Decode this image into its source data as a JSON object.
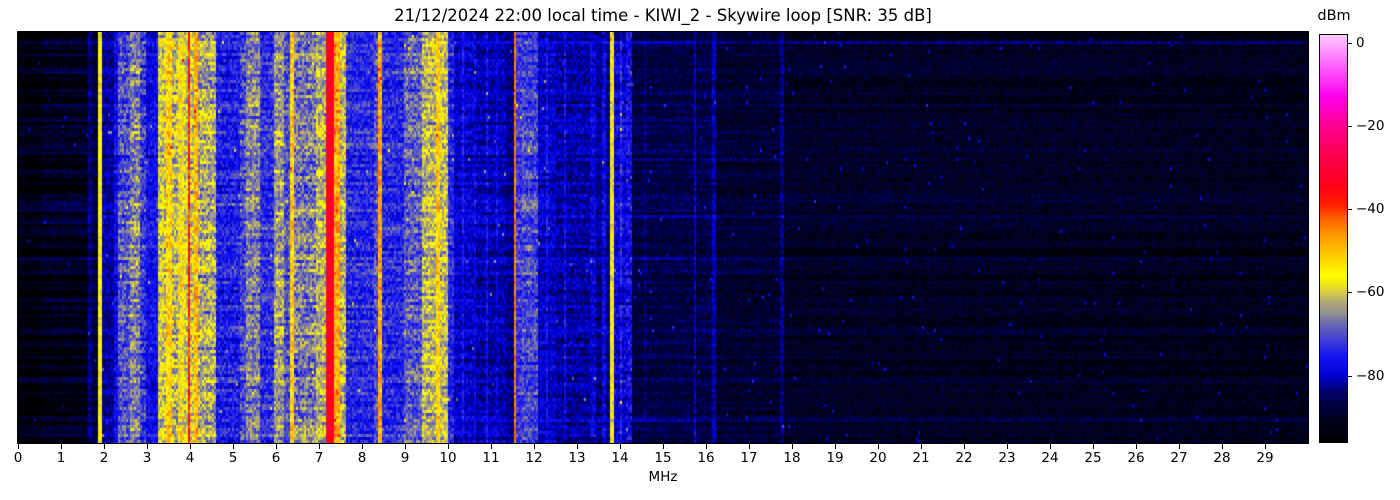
{
  "header": {
    "title": "21/12/2024 22:00 local time - KIWI_2 - Skywire loop [SNR: 35 dB]"
  },
  "chart_data": {
    "type": "heatmap",
    "variant": "radio-spectrum-waterfall",
    "title": "21/12/2024 22:00 local time - KIWI_2 - Skywire loop [SNR: 35 dB]",
    "xlabel": "MHz",
    "x_range": [
      0,
      30
    ],
    "x_ticks": [
      0,
      1,
      2,
      3,
      4,
      5,
      6,
      7,
      8,
      9,
      10,
      11,
      12,
      13,
      14,
      15,
      16,
      17,
      18,
      19,
      20,
      21,
      22,
      23,
      24,
      25,
      26,
      27,
      28,
      29
    ],
    "y_axis": {
      "meaning": "time (waterfall rows, no tick labels shown)",
      "ticks": []
    },
    "colorbar": {
      "label": "dBm",
      "vmin": -96,
      "vmax": 2,
      "ticks": [
        0,
        -20,
        -40,
        -60,
        -80
      ],
      "tick_labels": [
        "0",
        "−20",
        "−40",
        "−60",
        "−80"
      ]
    },
    "colormap_stops": [
      [
        0.0,
        "#000000"
      ],
      [
        0.06,
        "#000022"
      ],
      [
        0.12,
        "#000066"
      ],
      [
        0.165,
        "#0000d4"
      ],
      [
        0.21,
        "#1515f2"
      ],
      [
        0.25,
        "#3d3dd8"
      ],
      [
        0.29,
        "#6a6ab2"
      ],
      [
        0.315,
        "#8f8f92"
      ],
      [
        0.34,
        "#aaa378"
      ],
      [
        0.365,
        "#d2c74a"
      ],
      [
        0.39,
        "#f2ea10"
      ],
      [
        0.41,
        "#ffff00"
      ],
      [
        0.46,
        "#ffc800"
      ],
      [
        0.51,
        "#ff9600"
      ],
      [
        0.55,
        "#ff5f00"
      ],
      [
        0.58,
        "#ff2000"
      ],
      [
        0.63,
        "#ff0018"
      ],
      [
        0.7,
        "#fb004c"
      ],
      [
        0.775,
        "#ff0090"
      ],
      [
        0.85,
        "#ff00ee"
      ],
      [
        0.92,
        "#ff5cff"
      ],
      [
        1.0,
        "#ffc8ff"
      ]
    ],
    "bands_comment": "frequency bands [fStartMHz, fEndMHz, baseLevel_dBm, variability_dB] read from the screenshot",
    "bands": [
      [
        0.0,
        0.55,
        -94,
        3
      ],
      [
        0.55,
        1.62,
        -92,
        4
      ],
      [
        1.62,
        1.7,
        -84,
        5
      ],
      [
        1.7,
        1.88,
        -88,
        4
      ],
      [
        1.88,
        1.96,
        -57,
        3
      ],
      [
        1.96,
        2.22,
        -82,
        5
      ],
      [
        2.22,
        2.34,
        -77,
        5
      ],
      [
        2.34,
        2.62,
        -70,
        8
      ],
      [
        2.62,
        2.82,
        -66,
        8
      ],
      [
        2.82,
        2.98,
        -72,
        8
      ],
      [
        2.98,
        3.26,
        -77,
        6
      ],
      [
        3.26,
        3.42,
        -60,
        9
      ],
      [
        3.42,
        3.6,
        -52,
        8
      ],
      [
        3.6,
        3.74,
        -62,
        9
      ],
      [
        3.74,
        3.88,
        -56,
        9
      ],
      [
        3.88,
        3.94,
        -60,
        8
      ],
      [
        3.94,
        3.99,
        -38,
        8
      ],
      [
        3.99,
        4.1,
        -60,
        8
      ],
      [
        4.1,
        4.18,
        -50,
        8
      ],
      [
        4.18,
        4.6,
        -63,
        9
      ],
      [
        4.6,
        5.15,
        -75,
        7
      ],
      [
        5.15,
        5.32,
        -71,
        8
      ],
      [
        5.32,
        5.62,
        -66,
        8
      ],
      [
        5.62,
        5.95,
        -73,
        7
      ],
      [
        5.95,
        6.2,
        -64,
        8
      ],
      [
        6.2,
        6.33,
        -70,
        7
      ],
      [
        6.33,
        6.43,
        -52,
        7
      ],
      [
        6.43,
        6.95,
        -67,
        9
      ],
      [
        6.95,
        7.17,
        -62,
        8
      ],
      [
        7.17,
        7.37,
        -33,
        3
      ],
      [
        7.37,
        7.48,
        -48,
        7
      ],
      [
        7.48,
        7.62,
        -62,
        8
      ],
      [
        7.62,
        8.28,
        -74,
        7
      ],
      [
        8.28,
        8.37,
        -70,
        7
      ],
      [
        8.37,
        8.45,
        -48,
        6
      ],
      [
        8.45,
        9.0,
        -74,
        7
      ],
      [
        9.0,
        9.4,
        -69,
        8
      ],
      [
        9.4,
        9.7,
        -62,
        8
      ],
      [
        9.7,
        9.8,
        -52,
        7
      ],
      [
        9.8,
        9.98,
        -61,
        8
      ],
      [
        9.98,
        10.15,
        -74,
        6
      ],
      [
        10.15,
        10.6,
        -80,
        5
      ],
      [
        10.6,
        11.35,
        -81,
        5
      ],
      [
        11.35,
        11.52,
        -83,
        4
      ],
      [
        11.52,
        11.6,
        -44,
        4
      ],
      [
        11.6,
        11.7,
        -72,
        6
      ],
      [
        11.7,
        12.1,
        -71,
        7
      ],
      [
        12.1,
        12.5,
        -80,
        5
      ],
      [
        12.5,
        13.3,
        -82,
        5
      ],
      [
        13.3,
        13.42,
        -79,
        5
      ],
      [
        13.42,
        13.58,
        -83,
        4
      ],
      [
        13.58,
        13.66,
        -78,
        5
      ],
      [
        13.66,
        13.78,
        -83,
        4
      ],
      [
        13.78,
        13.88,
        -57,
        5
      ],
      [
        13.88,
        14.12,
        -79,
        6
      ],
      [
        14.12,
        14.3,
        -77,
        7
      ],
      [
        14.3,
        15.7,
        -87,
        4
      ],
      [
        15.7,
        15.78,
        -80,
        4
      ],
      [
        15.78,
        16.14,
        -87,
        4
      ],
      [
        16.14,
        16.22,
        -81,
        4
      ],
      [
        16.22,
        17.7,
        -89,
        4
      ],
      [
        17.7,
        17.8,
        -83,
        4
      ],
      [
        17.8,
        30.0,
        -90,
        4
      ]
    ],
    "thin_lines_comment": "faint narrow carriers [fMHz, boost_dB]",
    "thin_lines": [
      [
        10.35,
        4
      ],
      [
        10.62,
        3
      ],
      [
        10.9,
        4
      ],
      [
        11.15,
        3
      ],
      [
        12.3,
        4
      ],
      [
        12.7,
        5
      ],
      [
        14.02,
        5
      ],
      [
        14.56,
        3
      ]
    ],
    "row_events_comment": "horizontal faint lines across quiet spectrum [rowFraction, boost_dB]",
    "row_events": [
      [
        0.022,
        5
      ],
      [
        0.148,
        3
      ],
      [
        0.31,
        4
      ],
      [
        0.447,
        6
      ],
      [
        0.55,
        3
      ],
      [
        0.72,
        3
      ],
      [
        0.944,
        5
      ]
    ],
    "noise": {
      "row_stripe_db": 5,
      "stripe_gain_below_1_65MHz": 2.2,
      "stripe_gain_default": 0.6,
      "sparkle_prob": 0.004,
      "sparkle_db": 12,
      "fade_above_18MHz_db_per_MHz": 0.12
    },
    "seed": 20241221
  }
}
